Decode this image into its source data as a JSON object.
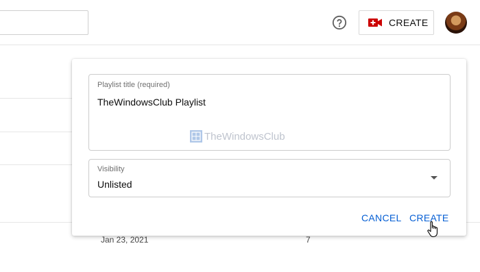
{
  "topbar": {
    "search": {
      "value": ""
    },
    "help_icon": "question-circle-icon",
    "create_button": {
      "label": "CREATE",
      "icon": "video-camera-plus-icon",
      "icon_color": "#cc0000"
    },
    "avatar": "user-avatar"
  },
  "background_table": {
    "row": {
      "date": "Jan 23, 2021",
      "count": "7"
    }
  },
  "dialog": {
    "title_field": {
      "label": "Playlist title (required)",
      "value": "TheWindowsClub Playlist"
    },
    "visibility_field": {
      "label": "Visibility",
      "value": "Unlisted"
    },
    "watermark": "TheWindowsClub",
    "actions": {
      "cancel": "CANCEL",
      "create": "CREATE"
    },
    "accent_color": "#065fd4"
  }
}
